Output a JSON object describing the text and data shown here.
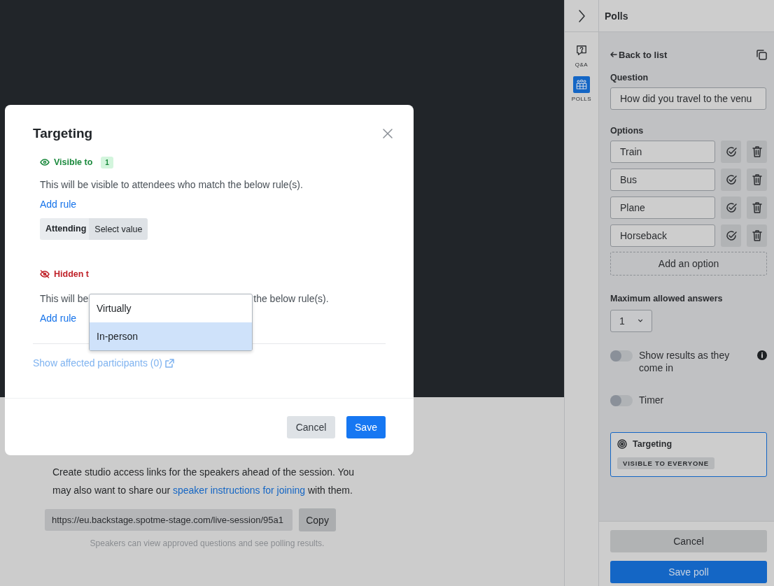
{
  "session": {
    "text_before": "Create studio access links for the speakers ahead of the session. You may also want to share our ",
    "link": "speaker instructions for joining",
    "text_after": " with them.",
    "url": "https://eu.backstage.spotme-stage.com/live-session/95a1",
    "copy": "Copy",
    "caption": "Speakers can view approved questions and see polling results."
  },
  "rail": [
    {
      "kind": "qa",
      "label": "Q&A",
      "selected": false
    },
    {
      "kind": "polls",
      "label": "POLLS",
      "selected": true
    }
  ],
  "panel": {
    "title": "Polls",
    "back": "Back to list",
    "question_label": "Question",
    "question": "How did you travel to the venu",
    "options_label": "Options",
    "options": [
      "Train",
      "Bus",
      "Plane",
      "Horseback"
    ],
    "add_option": "Add an option",
    "max_label": "Maximum allowed answers",
    "max_value": "1",
    "toggles": [
      {
        "label": "Show results as they come in",
        "on": false,
        "info": true
      },
      {
        "label": "Timer",
        "on": false,
        "info": false
      }
    ],
    "targeting": {
      "title": "Targeting",
      "badge": "VISIBLE TO EVERYONE"
    },
    "cancel": "Cancel",
    "save": "Save poll"
  },
  "modal": {
    "title": "Targeting",
    "visible": {
      "label": "Visible to",
      "count": "1",
      "description": "This will be visible to attendees who match the below rule(s).",
      "add_rule": "Add rule",
      "rule": {
        "attribute": "Attending",
        "value": "Select value"
      }
    },
    "hidden": {
      "label": "Hidden t",
      "description_start": "This will be",
      "description_end": "the below rule(s).",
      "add_rule": "Add rule"
    },
    "dropdown": [
      {
        "label": "Virtually",
        "selected": false
      },
      {
        "label": "In-person",
        "selected": true
      }
    ],
    "affected": "Show affected participants (0)",
    "cancel": "Cancel",
    "save": "Save"
  }
}
